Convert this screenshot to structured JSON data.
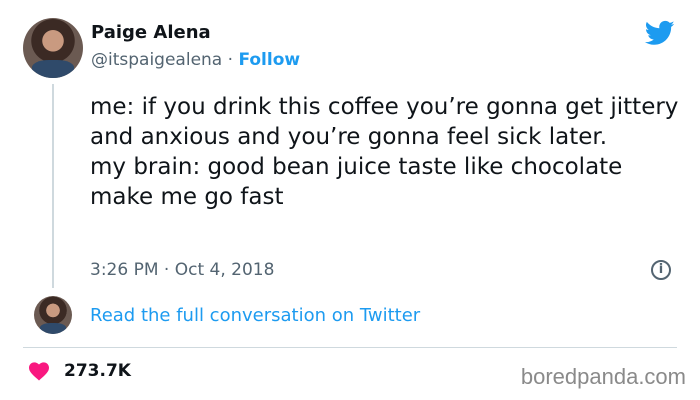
{
  "tweet": {
    "author_name": "Paige Alena",
    "handle": "@itspaigealena",
    "separator": "·",
    "follow_label": "Follow",
    "text": "me: if you drink this coffee you’re gonna get jittery and anxious and you’re gonna feel sick later.\nmy brain: good bean juice taste like chocolate make me go fast",
    "time": "3:26 PM",
    "date": "Oct 4, 2018",
    "likes": "273.7K",
    "read_full_label": "Read the full conversation on Twitter"
  },
  "watermark": "boredpanda.com",
  "icons": {
    "brand": "twitter-bird-icon",
    "info": "info-icon",
    "like": "heart-icon"
  },
  "colors": {
    "accent": "#1d9bf0",
    "heart": "#f91880",
    "secondary_text": "#536471"
  }
}
